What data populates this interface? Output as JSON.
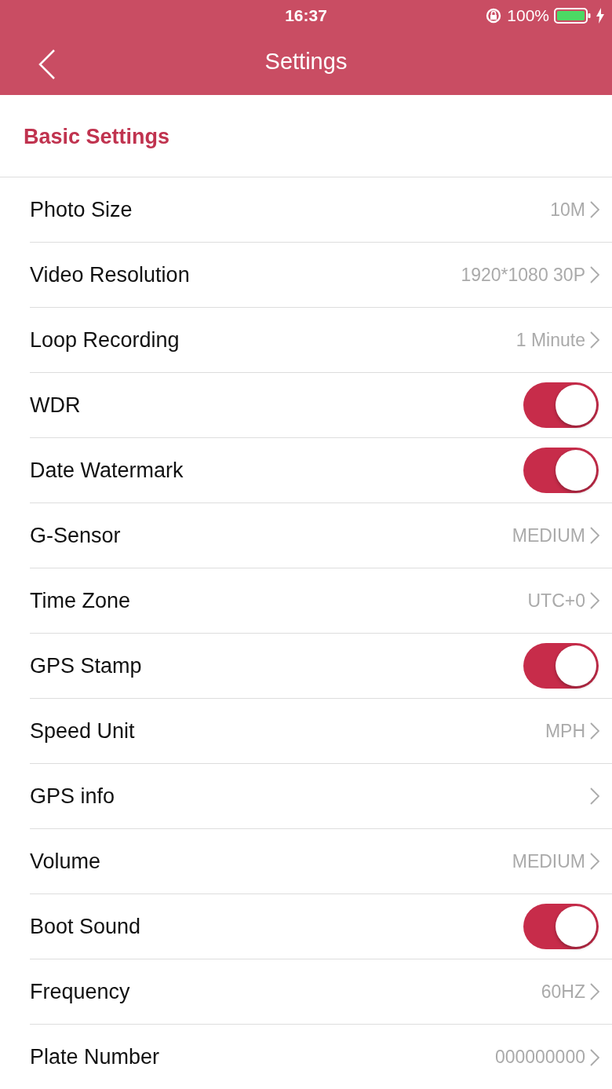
{
  "status_bar": {
    "time": "16:37",
    "battery": "100%"
  },
  "nav": {
    "title": "Settings"
  },
  "section": {
    "title": "Basic Settings"
  },
  "rows": [
    {
      "kind": "value",
      "label": "Photo Size",
      "value": "10M"
    },
    {
      "kind": "value",
      "label": "Video Resolution",
      "value": "1920*1080 30P"
    },
    {
      "kind": "value",
      "label": "Loop Recording",
      "value": "1 Minute"
    },
    {
      "kind": "toggle",
      "label": "WDR",
      "on": true
    },
    {
      "kind": "toggle",
      "label": "Date Watermark",
      "on": true
    },
    {
      "kind": "value",
      "label": "G-Sensor",
      "value": "MEDIUM"
    },
    {
      "kind": "value",
      "label": "Time Zone",
      "value": "UTC+0"
    },
    {
      "kind": "toggle",
      "label": "GPS Stamp",
      "on": true
    },
    {
      "kind": "value",
      "label": "Speed Unit",
      "value": "MPH"
    },
    {
      "kind": "value",
      "label": "GPS info"
    },
    {
      "kind": "value",
      "label": "Volume",
      "value": "MEDIUM"
    },
    {
      "kind": "toggle",
      "label": "Boot Sound",
      "on": true
    },
    {
      "kind": "value",
      "label": "Frequency",
      "value": "60HZ"
    },
    {
      "kind": "value",
      "label": "Plate Number",
      "value": "000000000"
    }
  ]
}
